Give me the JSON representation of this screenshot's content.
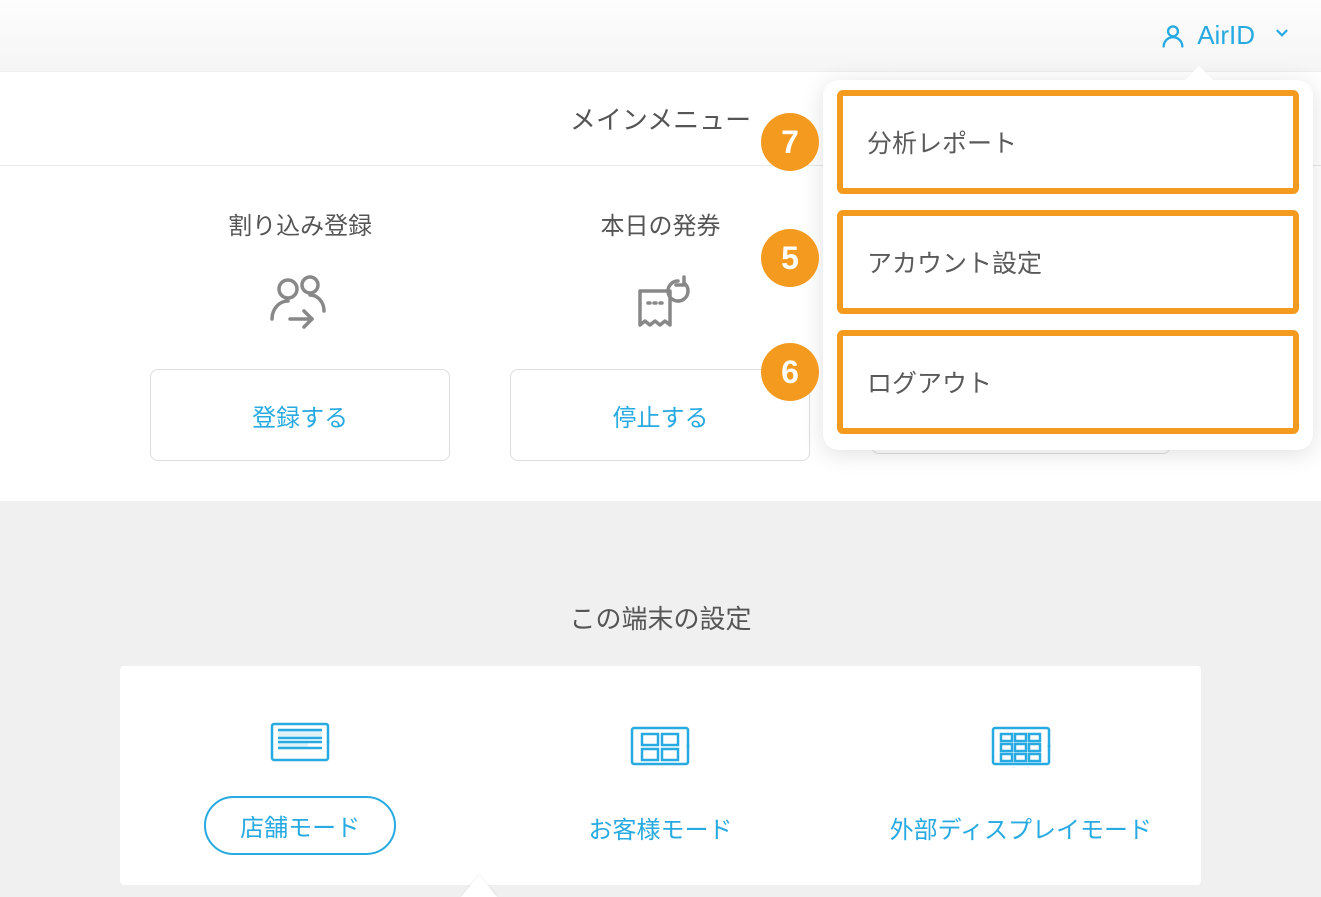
{
  "header": {
    "user_label": "AirID"
  },
  "main": {
    "section_title": "メインメニュー",
    "cards": [
      {
        "title": "割り込み登録",
        "button_label": "登録する"
      },
      {
        "title": "本日の発券",
        "button_label": "停止する"
      }
    ]
  },
  "device": {
    "title": "この端末の設定",
    "modes": [
      {
        "label": "店舗モード",
        "selected": true
      },
      {
        "label": "お客様モード",
        "selected": false
      },
      {
        "label": "外部ディスプレイモード",
        "selected": false
      }
    ]
  },
  "dropdown": {
    "items": [
      {
        "label": "分析レポート",
        "badge": "7"
      },
      {
        "label": "アカウント設定",
        "badge": "5"
      },
      {
        "label": "ログアウト",
        "badge": "6"
      }
    ]
  },
  "colors": {
    "accent": "#27aae1",
    "highlight": "#f39a1f"
  }
}
